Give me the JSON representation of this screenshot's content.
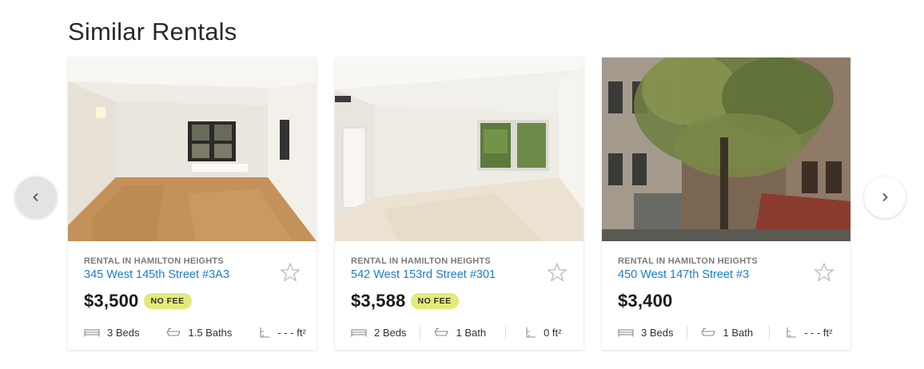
{
  "section": {
    "title": "Similar Rentals"
  },
  "carousel": {
    "prev_icon": "chevron-left-icon",
    "next_icon": "chevron-right-icon",
    "listings": [
      {
        "neighborhood": "RENTAL IN HAMILTON HEIGHTS",
        "address": "345 West 145th Street #3A3",
        "price": "$3,500",
        "badge": "NO FEE",
        "beds": "3 Beds",
        "baths": "1.5 Baths",
        "area": "- - - ft²",
        "photo": "interior-parquet-room"
      },
      {
        "neighborhood": "RENTAL IN HAMILTON HEIGHTS",
        "address": "542 West 153rd Street #301",
        "price": "$3,588",
        "badge": "NO FEE",
        "beds": "2 Beds",
        "baths": "1 Bath",
        "area": "0 ft²",
        "photo": "interior-white-room"
      },
      {
        "neighborhood": "RENTAL IN HAMILTON HEIGHTS",
        "address": "450 West 147th Street #3",
        "price": "$3,400",
        "badge": "",
        "beds": "3 Beds",
        "baths": "1 Bath",
        "area": "- - - ft²",
        "photo": "brownstone-exterior-tree"
      }
    ]
  },
  "colors": {
    "link": "#1e7fc1",
    "badge": "#e4ea78",
    "muted": "#7b7b7b"
  }
}
